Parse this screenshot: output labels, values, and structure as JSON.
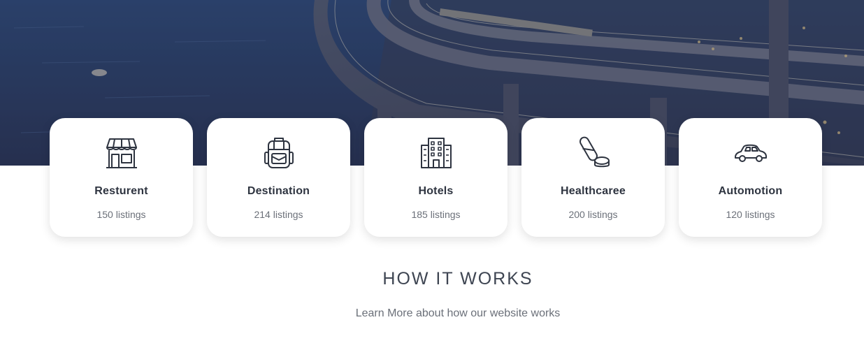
{
  "hero": {
    "image": "night city highway interchange over water"
  },
  "categories": [
    {
      "icon": "store-icon",
      "title": "Resturent",
      "count": "150 listings"
    },
    {
      "icon": "backpack-icon",
      "title": "Destination",
      "count": "214 listings"
    },
    {
      "icon": "hotel-building-icon",
      "title": "Hotels",
      "count": "185 listings"
    },
    {
      "icon": "pill-icon",
      "title": "Healthcaree",
      "count": "200 listings"
    },
    {
      "icon": "car-icon",
      "title": "Automotion",
      "count": "120 listings"
    }
  ],
  "how_it_works": {
    "heading": "HOW IT WORKS",
    "subtitle": "Learn More about how our website works"
  },
  "colors": {
    "card_bg": "#ffffff",
    "heading": "#3e4552",
    "muted_text": "#6b7079",
    "icon_stroke": "#2e3440"
  }
}
